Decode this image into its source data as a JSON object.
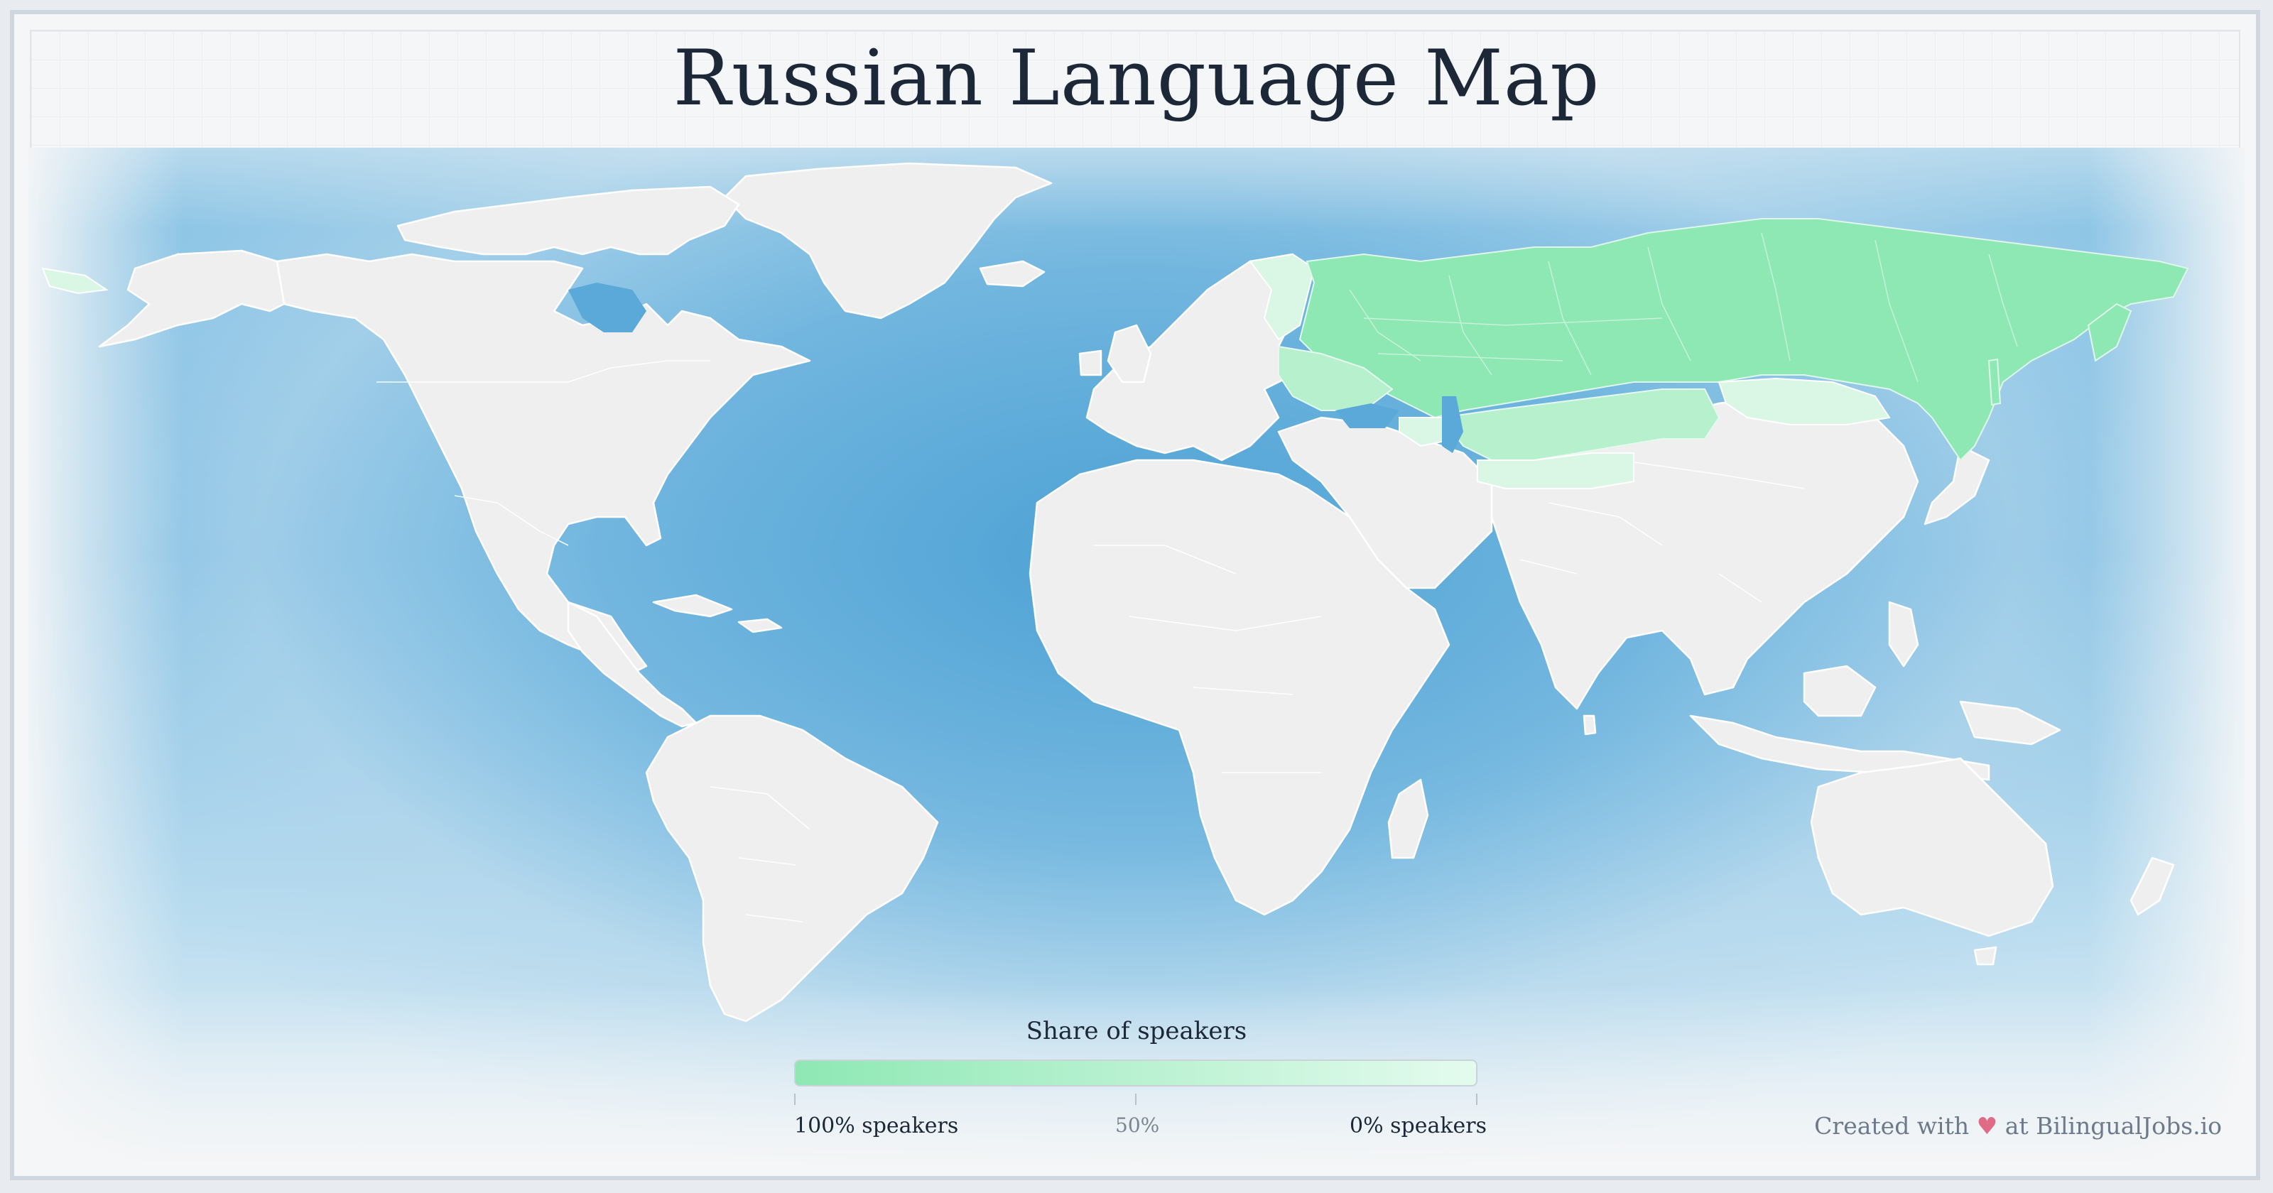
{
  "page": {
    "title": "Russian Language Map"
  },
  "legend": {
    "title": "Share of speakers",
    "gradient_start": "#8ee8b4",
    "gradient_end": "#e4fbee",
    "labels": {
      "left": "100% speakers",
      "middle": "50%",
      "right": "0% speakers"
    }
  },
  "credit": {
    "prefix": "Created with",
    "heart_icon": "heart-icon",
    "heart_glyph": "♥",
    "suffix": "at BilingualJobs.io"
  },
  "colors": {
    "ocean": "#4ea6d8",
    "land": "#efefef",
    "highlight_full": "#8ee8b4",
    "highlight_partial": "#d9f7e4",
    "heart": "#e06b86"
  },
  "map_regions": {
    "highlighted_full": [
      "Russia",
      "Belarus"
    ],
    "highlighted_partial": [
      "Ukraine",
      "Kazakhstan",
      "Kyrgyzstan",
      "Latvia",
      "Estonia",
      "Moldova",
      "Uzbekistan",
      "Turkmenistan",
      "Tajikistan",
      "Azerbaijan",
      "Armenia",
      "Georgia",
      "Finland"
    ]
  }
}
